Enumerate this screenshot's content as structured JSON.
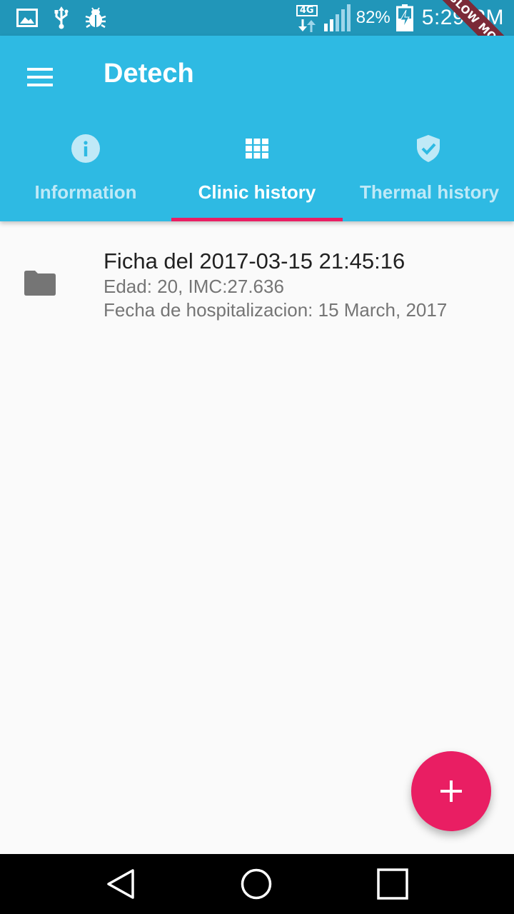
{
  "status_bar": {
    "left_icons": [
      "gallery-icon",
      "usb-icon",
      "bug-icon"
    ],
    "network_type": "4G",
    "battery_percent": "82%",
    "time": "5:29 PM",
    "slow_mode_banner": "SLOW MODE"
  },
  "app_bar": {
    "title": "Detech",
    "menu_icon": "menu-icon"
  },
  "tabs": [
    {
      "label": "Information",
      "icon": "info-icon",
      "active": false
    },
    {
      "label": "Clinic history",
      "icon": "grid-icon",
      "active": true
    },
    {
      "label": "Thermal history",
      "icon": "shield-check-icon",
      "active": false
    }
  ],
  "records": [
    {
      "icon": "folder-icon",
      "title": "Ficha del 2017-03-15 21:45:16",
      "line1": "Edad: 20, IMC:27.636",
      "line2": "Fecha de hospitalizacion: 15 March, 2017"
    }
  ],
  "fab": {
    "icon": "plus-icon"
  },
  "nav_bar": {
    "icons": [
      "back-icon",
      "home-icon",
      "recents-icon"
    ]
  },
  "colors": {
    "status_bar": "#2196b9",
    "app_bar": "#2ebae3",
    "tab_indicator": "#e91e63",
    "fab": "#e91e63",
    "background": "#fafafa"
  }
}
